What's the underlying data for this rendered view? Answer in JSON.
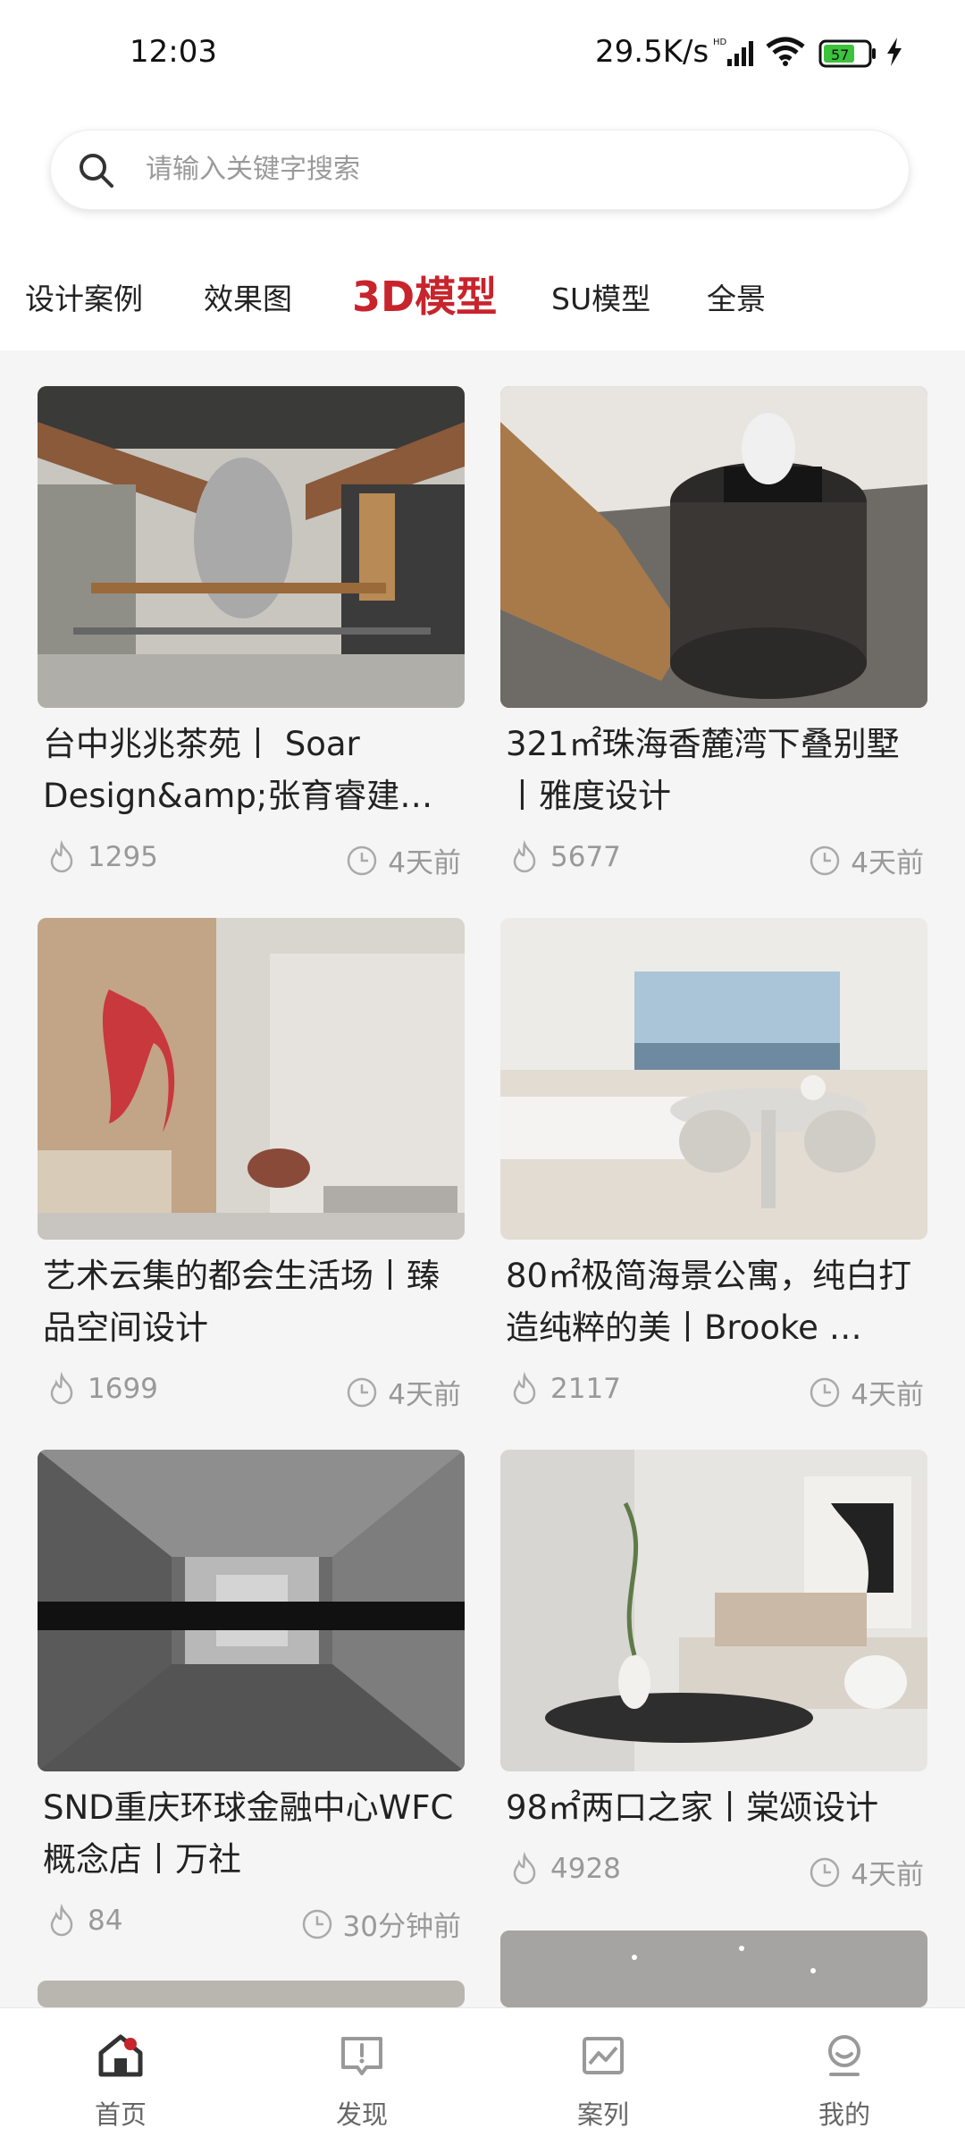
{
  "status_bar": {
    "time": "12:03",
    "network_speed": "29.5K/s",
    "battery_level": "57"
  },
  "search": {
    "placeholder": "请输入关键字搜索"
  },
  "tabs": [
    {
      "label": "设计案例",
      "active": false
    },
    {
      "label": "效果图",
      "active": false
    },
    {
      "label": "3D模型",
      "active": true
    },
    {
      "label": "SU模型",
      "active": false
    },
    {
      "label": "全景",
      "active": false
    }
  ],
  "cards": [
    {
      "title": "台中兆兆茶苑丨 Soar Design&amp;张育睿建…",
      "views": "1295",
      "time": "4天前"
    },
    {
      "title": "321㎡珠海香麓湾下叠别墅丨雅度设计",
      "views": "5677",
      "time": "4天前"
    },
    {
      "title": "艺术云集的都会生活场丨臻品空间设计",
      "views": "1699",
      "time": "4天前"
    },
    {
      "title": "80㎡极简海景公寓，纯白打造纯粹的美丨Brooke …",
      "views": "2117",
      "time": "4天前"
    },
    {
      "title": "SND重庆环球金融中心WFC 概念店丨万社",
      "views": "84",
      "time": "30分钟前"
    },
    {
      "title": "98㎡两口之家丨棠颂设计",
      "views": "4928",
      "time": "4天前"
    }
  ],
  "bottom_nav": [
    {
      "label": "首页",
      "icon": "home-icon",
      "active": true
    },
    {
      "label": "发现",
      "icon": "discover-icon",
      "active": false
    },
    {
      "label": "案列",
      "icon": "case-icon",
      "active": false
    },
    {
      "label": "我的",
      "icon": "profile-icon",
      "active": false
    }
  ],
  "colors": {
    "accent": "#c8242c",
    "background": "#f5f5f5"
  }
}
